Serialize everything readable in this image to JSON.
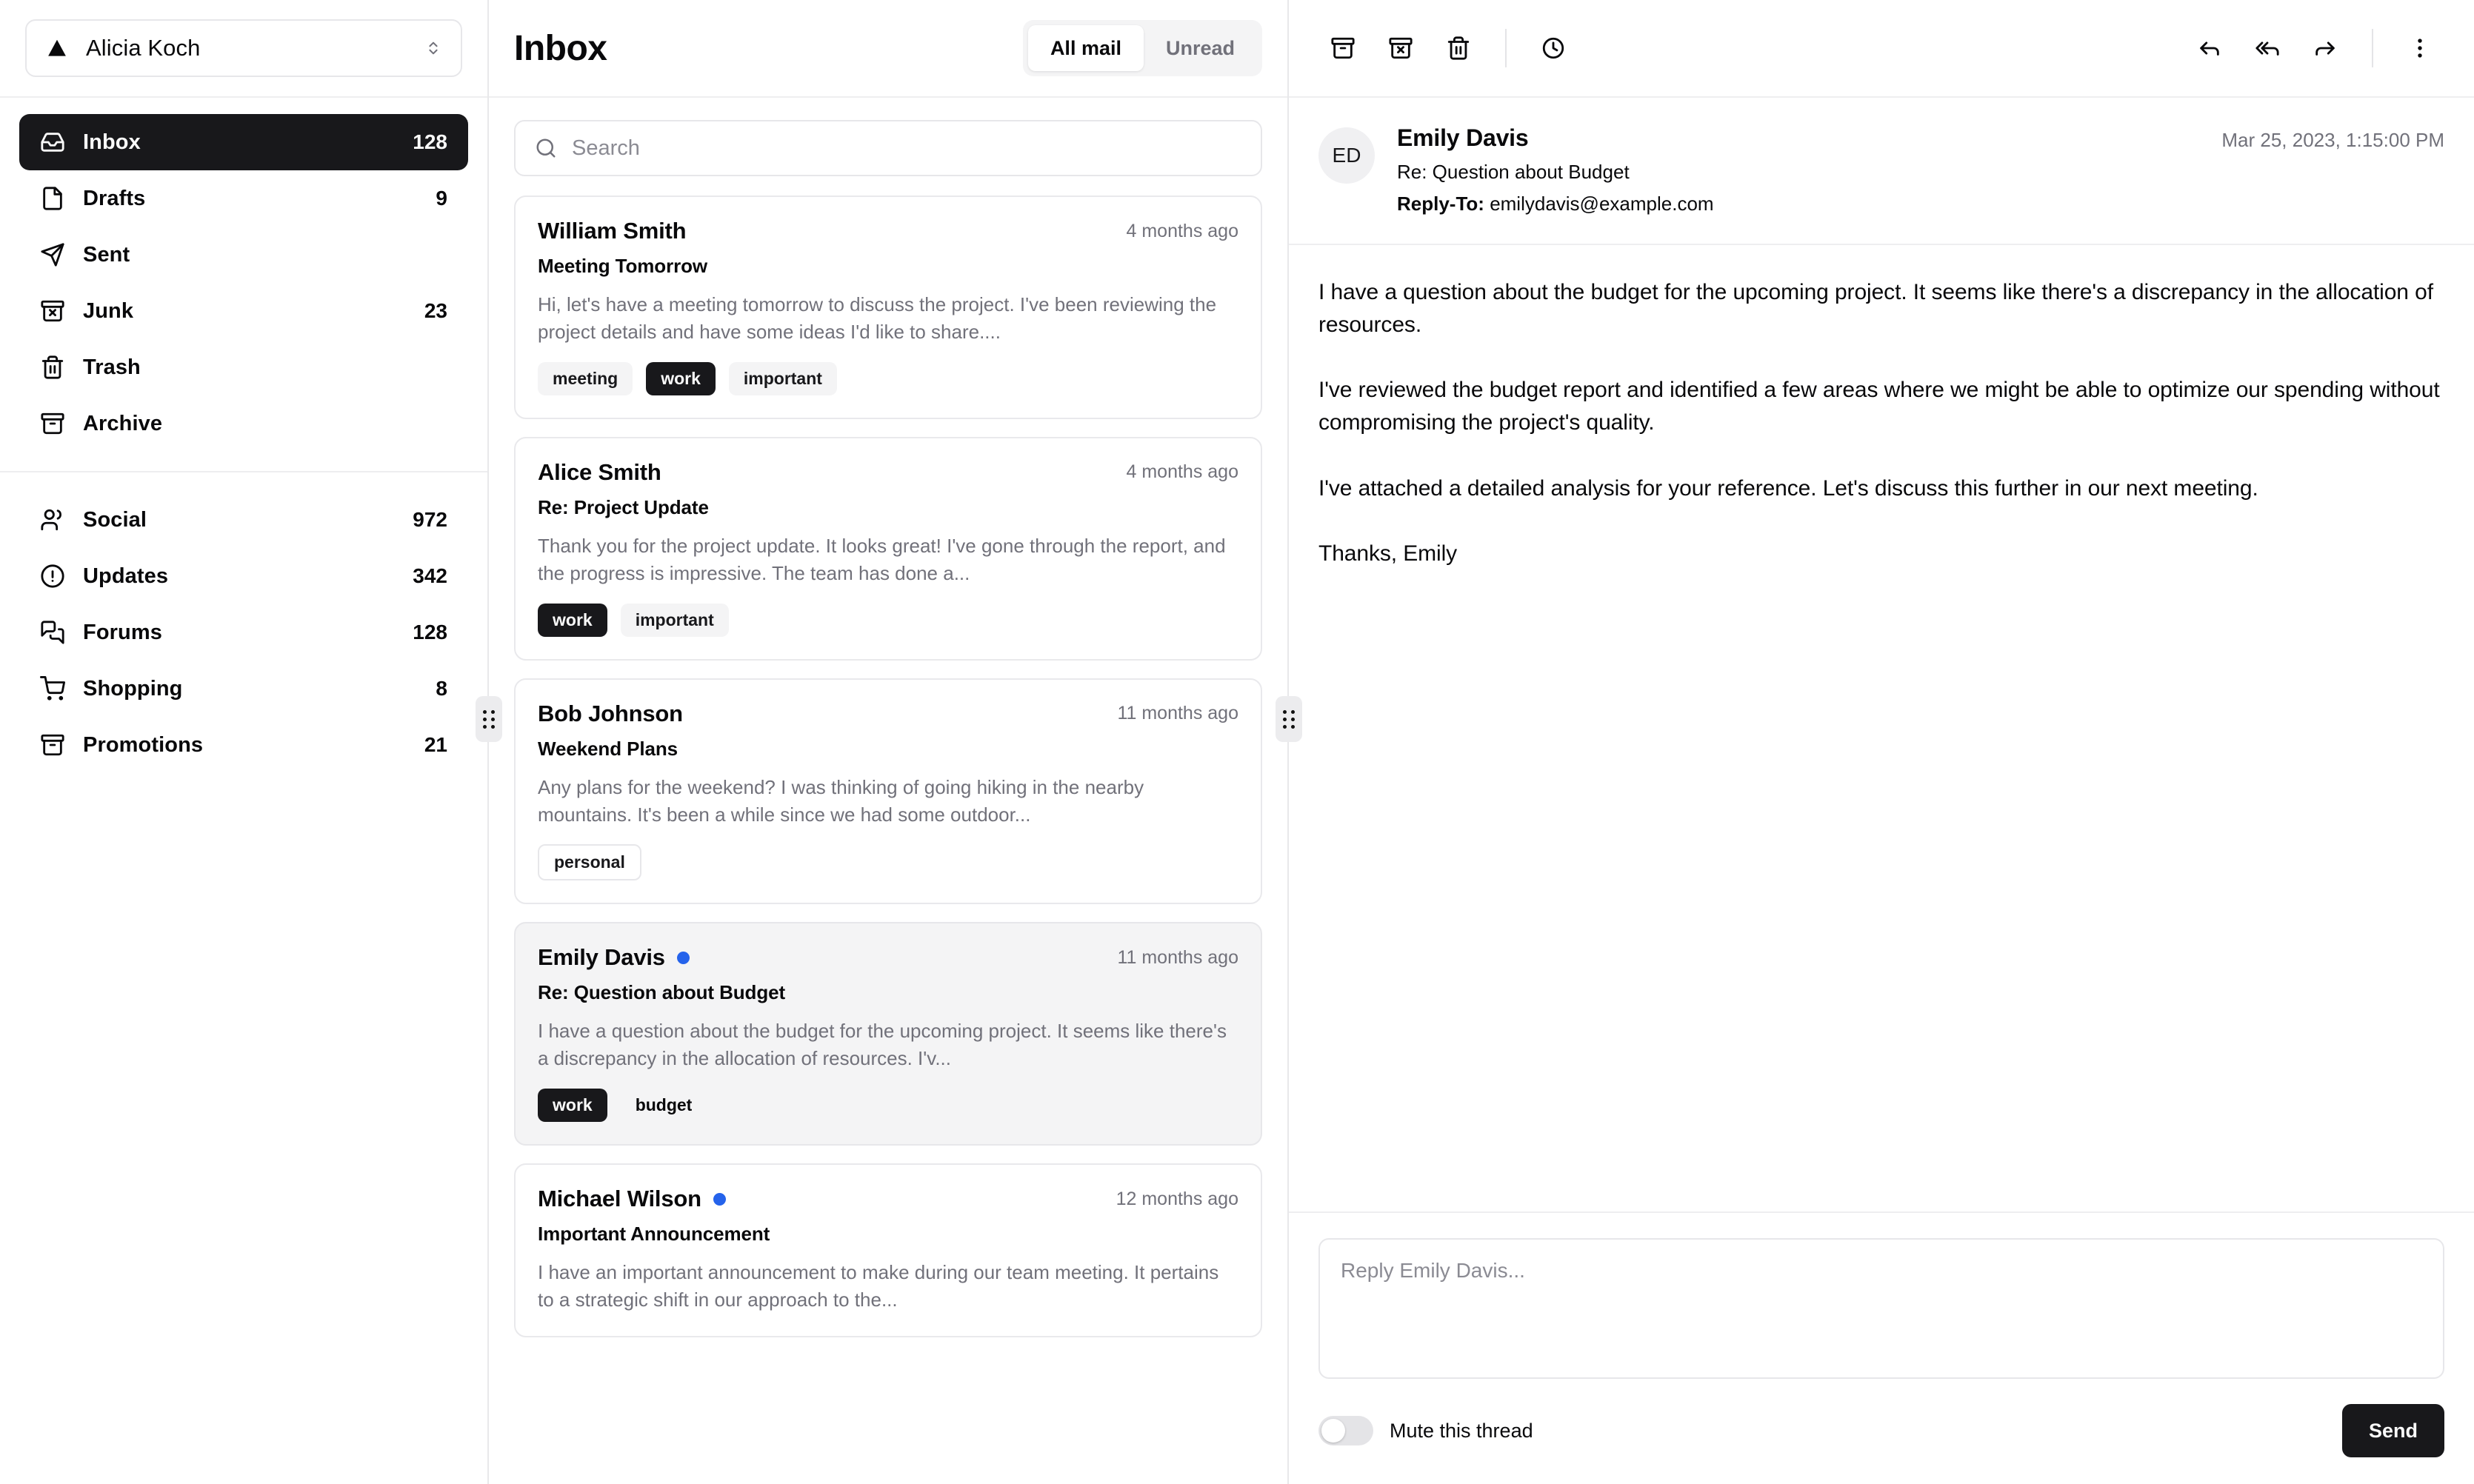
{
  "sidebar": {
    "account": {
      "name": "Alicia Koch",
      "icon": "triangle-logo",
      "chevron_icon": "chevrons-up-down-icon"
    },
    "primary_items": [
      {
        "label": "Inbox",
        "count": "128",
        "icon": "inbox-icon",
        "active": true
      },
      {
        "label": "Drafts",
        "count": "9",
        "icon": "file-icon",
        "active": false
      },
      {
        "label": "Sent",
        "count": "",
        "icon": "send-icon",
        "active": false
      },
      {
        "label": "Junk",
        "count": "23",
        "icon": "archive-x-icon",
        "active": false
      },
      {
        "label": "Trash",
        "count": "",
        "icon": "trash-icon",
        "active": false
      },
      {
        "label": "Archive",
        "count": "",
        "icon": "archive-icon",
        "active": false
      }
    ],
    "secondary_items": [
      {
        "label": "Social",
        "count": "972",
        "icon": "users-icon"
      },
      {
        "label": "Updates",
        "count": "342",
        "icon": "alert-circle-icon"
      },
      {
        "label": "Forums",
        "count": "128",
        "icon": "message-square-icon"
      },
      {
        "label": "Shopping",
        "count": "8",
        "icon": "shopping-cart-icon"
      },
      {
        "label": "Promotions",
        "count": "21",
        "icon": "archive-icon"
      }
    ]
  },
  "list": {
    "title": "Inbox",
    "tabs": [
      {
        "label": "All mail",
        "active": true
      },
      {
        "label": "Unread",
        "active": false
      }
    ],
    "search": {
      "placeholder": "Search",
      "value": "",
      "icon": "search-icon"
    },
    "emails": [
      {
        "name": "William Smith",
        "time": "4 months ago",
        "subject": "Meeting Tomorrow",
        "snippet": "Hi, let's have a meeting tomorrow to discuss the project. I've been reviewing the project details and have some ideas I'd like to share....",
        "unread": false,
        "selected": false,
        "tags": [
          {
            "label": "meeting",
            "variant": "secondary"
          },
          {
            "label": "work",
            "variant": "default"
          },
          {
            "label": "important",
            "variant": "secondary"
          }
        ]
      },
      {
        "name": "Alice Smith",
        "time": "4 months ago",
        "subject": "Re: Project Update",
        "snippet": "Thank you for the project update. It looks great! I've gone through the report, and the progress is impressive. The team has done a...",
        "unread": false,
        "selected": false,
        "tags": [
          {
            "label": "work",
            "variant": "default"
          },
          {
            "label": "important",
            "variant": "secondary"
          }
        ]
      },
      {
        "name": "Bob Johnson",
        "time": "11 months ago",
        "subject": "Weekend Plans",
        "snippet": "Any plans for the weekend? I was thinking of going hiking in the nearby mountains. It's been a while since we had some outdoor...",
        "unread": false,
        "selected": false,
        "tags": [
          {
            "label": "personal",
            "variant": "outline"
          }
        ]
      },
      {
        "name": "Emily Davis",
        "time": "11 months ago",
        "subject": "Re: Question about Budget",
        "snippet": "I have a question about the budget for the upcoming project. It seems like there's a discrepancy in the allocation of resources. I'v...",
        "unread": true,
        "selected": true,
        "tags": [
          {
            "label": "work",
            "variant": "default"
          },
          {
            "label": "budget",
            "variant": "ghost"
          }
        ]
      },
      {
        "name": "Michael Wilson",
        "time": "12 months ago",
        "subject": "Important Announcement",
        "snippet": "I have an important announcement to make during our team meeting. It pertains to a strategic shift in our approach to the...",
        "unread": true,
        "selected": false,
        "tags": []
      }
    ]
  },
  "reader": {
    "toolbar_left": [
      {
        "icon": "archive-icon",
        "name": "archive-button"
      },
      {
        "icon": "archive-x-icon",
        "name": "move-to-junk-button"
      },
      {
        "icon": "trash-icon",
        "name": "move-to-trash-button"
      }
    ],
    "toolbar_snooze": {
      "icon": "clock-icon",
      "name": "snooze-button"
    },
    "toolbar_right": [
      {
        "icon": "reply-icon",
        "name": "reply-button"
      },
      {
        "icon": "reply-all-icon",
        "name": "reply-all-button"
      },
      {
        "icon": "forward-icon",
        "name": "forward-button"
      }
    ],
    "toolbar_more": {
      "icon": "more-vertical-icon",
      "name": "more-options-button"
    },
    "message": {
      "avatar_initials": "ED",
      "sender": "Emily Davis",
      "subject": "Re: Question about Budget",
      "reply_to_label": "Reply-To:",
      "reply_to_email": "emilydavis@example.com",
      "date": "Mar 25, 2023, 1:15:00 PM",
      "body": "I have a question about the budget for the upcoming project. It seems like there's a discrepancy in the allocation of resources.\n\nI've reviewed the budget report and identified a few areas where we might be able to optimize our spending without compromising the project's quality.\n\nI've attached a detailed analysis for your reference. Let's discuss this further in our next meeting.\n\nThanks, Emily"
    },
    "reply": {
      "placeholder": "Reply Emily Davis...",
      "value": "",
      "mute_label": "Mute this thread",
      "mute_on": false,
      "send_label": "Send"
    }
  },
  "colors": {
    "accent_dark": "#18181b",
    "unread_dot": "#2563eb",
    "muted_bg": "#f4f4f5",
    "border": "#e7e7ea",
    "muted_text": "#71717a"
  }
}
